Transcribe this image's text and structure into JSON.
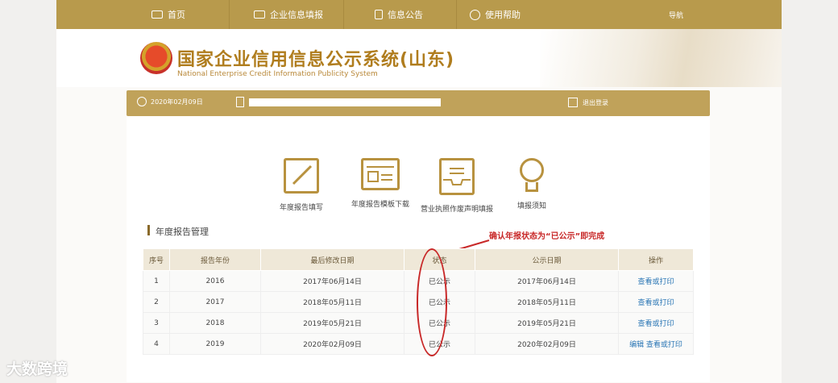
{
  "nav": {
    "items": [
      {
        "label": "首页",
        "icon": "monitor-icon"
      },
      {
        "label": "企业信息填报",
        "icon": "edit-icon"
      },
      {
        "label": "信息公告",
        "icon": "document-icon"
      },
      {
        "label": "使用帮助",
        "icon": "help-icon"
      }
    ],
    "guide": "导航"
  },
  "header": {
    "title_cn": "国家企业信用信息公示系统(山东)",
    "title_en": "National Enterprise Credit Information Publicity System"
  },
  "userbar": {
    "date": "2020年02月09日",
    "logout": "退出登录"
  },
  "tiles": [
    "年度报告填写",
    "年度报告模板下载",
    "营业执照作废声明填报",
    "填报须知"
  ],
  "section": {
    "title": "年度报告管理",
    "annotation": "确认年报状态为“已公示”即完成"
  },
  "table": {
    "headers": [
      "序号",
      "报告年份",
      "最后修改日期",
      "状态",
      "公示日期",
      "操作"
    ],
    "rows": [
      {
        "no": "1",
        "year": "2016",
        "modified": "2017年06月14日",
        "status": "已公示",
        "published": "2017年06月14日",
        "op": "查看或打印"
      },
      {
        "no": "2",
        "year": "2017",
        "modified": "2018年05月11日",
        "status": "已公示",
        "published": "2018年05月11日",
        "op": "查看或打印"
      },
      {
        "no": "3",
        "year": "2018",
        "modified": "2019年05月21日",
        "status": "已公示",
        "published": "2019年05月21日",
        "op": "查看或打印"
      },
      {
        "no": "4",
        "year": "2019",
        "modified": "2020年02月09日",
        "status": "已公示",
        "published": "2020年02月09日",
        "op": "编辑 查看或打印"
      }
    ]
  },
  "watermark": "大数跨境",
  "colors": {
    "gold": "#b89a4c",
    "annotation": "#c82828",
    "link": "#2a76b5"
  }
}
